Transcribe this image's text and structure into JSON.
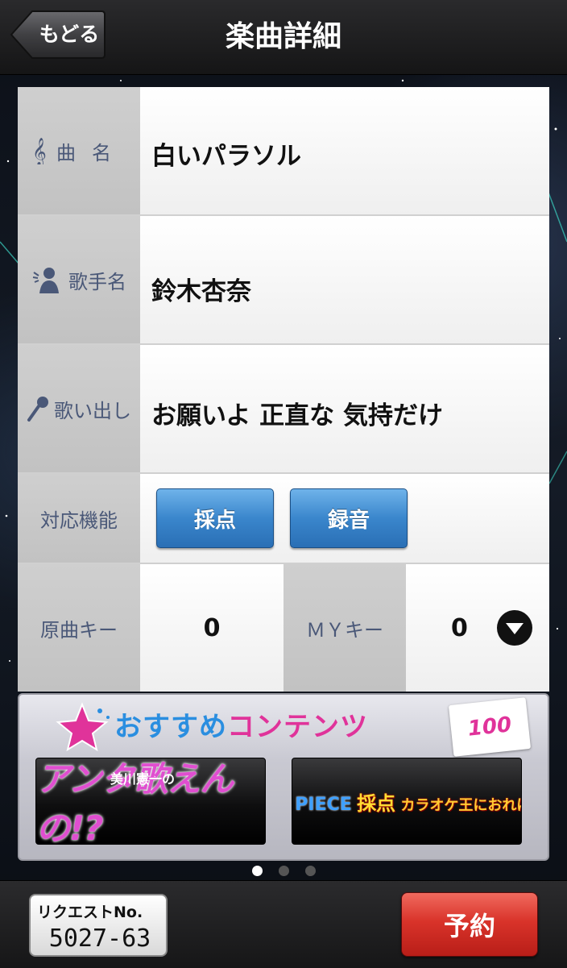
{
  "header": {
    "back_label": "もどる",
    "title": "楽曲詳細"
  },
  "details": {
    "song_label": "曲名",
    "song_value": "白いパラソル",
    "artist_label": "歌手名",
    "artist_value": "鈴木杏奈",
    "lyric_label": "歌い出し",
    "lyric_value": "お願いよ 正直な 気持だけ",
    "feature_label": "対応機能",
    "feature_buttons": [
      "採点",
      "録音"
    ],
    "original_key_label": "原曲キー",
    "original_key_value": "0",
    "my_key_label": "ＭＹキー",
    "my_key_value": "0"
  },
  "recommend": {
    "title_a": "おすすめ",
    "title_b": "コンテンツ",
    "badge": "100",
    "banners": [
      {
        "sub": "美川憲一の",
        "main": "アンタ歌えんの!?"
      },
      {
        "main_a": "ONE PIECE",
        "main_b": "採点",
        "main_c": "カラオケ王におれはなる!"
      }
    ]
  },
  "pager": {
    "pages": 3,
    "active": 0
  },
  "footer": {
    "request_label": "リクエストNo.",
    "request_number": "5027-63",
    "reserve_label": "予約"
  },
  "colors": {
    "label_text": "#4a5878",
    "func_button": "#3a86cc",
    "reserve_button": "#d9332a",
    "rec_blue": "#2a8ee0",
    "rec_pink": "#e0339a"
  }
}
